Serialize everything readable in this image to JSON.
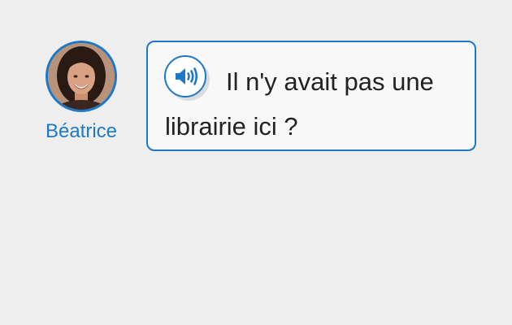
{
  "speaker": {
    "name": "Béatrice"
  },
  "message": {
    "text": "Il n'y avait pas une librairie ici ?"
  },
  "colors": {
    "accent": "#1e78c8",
    "background": "#eeeeee",
    "bubble": "#f8f8f8",
    "text": "#222222"
  },
  "icons": {
    "audio": "speaker-volume-icon",
    "avatar": "avatar-photo"
  }
}
